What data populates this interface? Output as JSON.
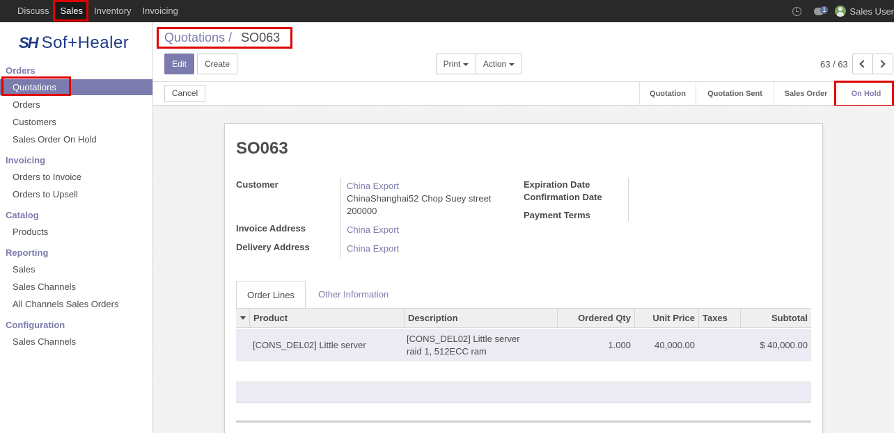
{
  "topbar": {
    "menu": [
      "Discuss",
      "Sales",
      "Inventory",
      "Invoicing"
    ],
    "active": "Sales",
    "chat_badge": "1",
    "user": "Sales User",
    "icons": [
      "clock-icon",
      "chat-icon",
      "user-avatar"
    ]
  },
  "sidebar": {
    "logo_mark": "SH",
    "logo_text": "Sof+Healer",
    "sections": [
      {
        "title": "Orders",
        "items": [
          "Quotations",
          "Orders",
          "Customers",
          "Sales Order On Hold"
        ]
      },
      {
        "title": "Invoicing",
        "items": [
          "Orders to Invoice",
          "Orders to Upsell"
        ]
      },
      {
        "title": "Catalog",
        "items": [
          "Products"
        ]
      },
      {
        "title": "Reporting",
        "items": [
          "Sales",
          "Sales Channels",
          "All Channels Sales Orders"
        ]
      },
      {
        "title": "Configuration",
        "items": [
          "Sales Channels"
        ]
      }
    ],
    "active_item": "Quotations"
  },
  "control": {
    "breadcrumb_parent": "Quotations",
    "breadcrumb_sep": "/",
    "breadcrumb_current": "SO063",
    "edit_label": "Edit",
    "create_label": "Create",
    "print_label": "Print",
    "action_label": "Action",
    "pager": "63 / 63"
  },
  "statusbar": {
    "cancel_label": "Cancel",
    "stages": [
      "Quotation",
      "Quotation Sent",
      "Sales Order",
      "On Hold"
    ],
    "current_stage": "On Hold"
  },
  "form": {
    "title": "SO063",
    "customer_label": "Customer",
    "customer_name": "China Export",
    "customer_addr_line1": "ChinaShanghai52 Chop Suey street",
    "customer_addr_line2": "200000",
    "invoice_address_label": "Invoice Address",
    "invoice_address": "China Export",
    "delivery_address_label": "Delivery Address",
    "delivery_address": "China Export",
    "expiration_date_label": "Expiration Date",
    "confirmation_date_label": "Confirmation Date",
    "payment_terms_label": "Payment Terms"
  },
  "tabs": [
    "Order Lines",
    "Other Information"
  ],
  "order_lines": {
    "columns": [
      "Product",
      "Description",
      "Ordered Qty",
      "Unit Price",
      "Taxes",
      "Subtotal"
    ],
    "rows": [
      {
        "product": "[CONS_DEL02] Little server",
        "description_line1": "[CONS_DEL02] Little server",
        "description_line2": "raid 1, 512ECC ram",
        "ordered_qty": "1.000",
        "unit_price": "40,000.00",
        "taxes": "",
        "subtotal": "$ 40,000.00"
      }
    ]
  },
  "colors": {
    "accent": "#7c7bad",
    "topbar": "#292929",
    "highlight": "#e00000"
  }
}
